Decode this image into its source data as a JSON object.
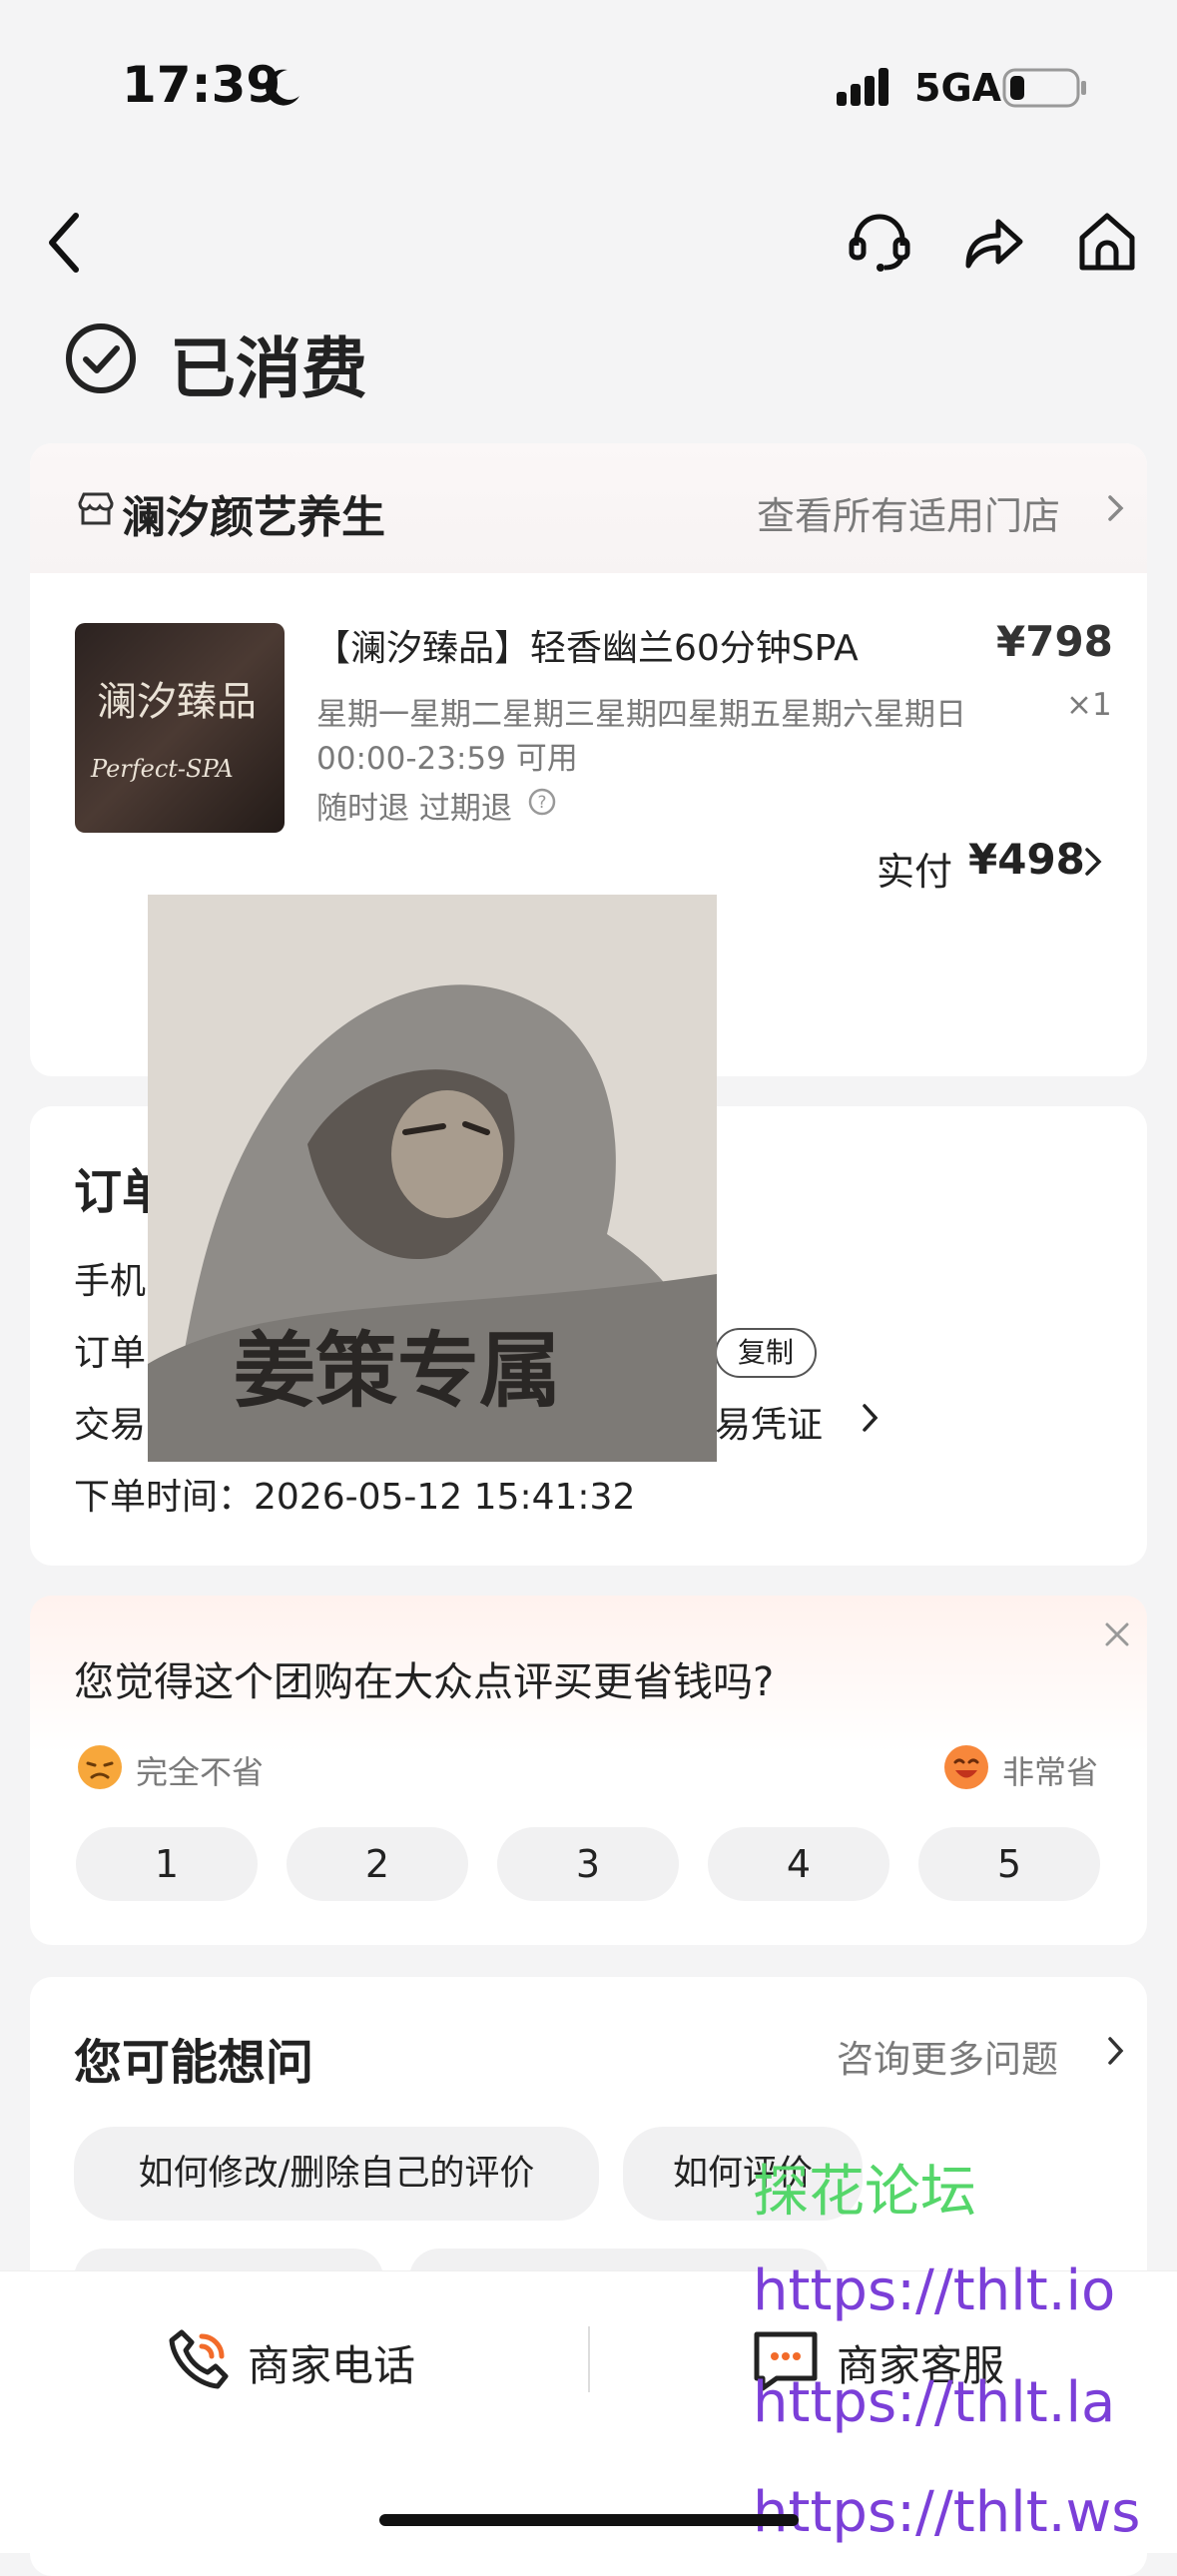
{
  "status_bar": {
    "time": "17:39",
    "network": "5GA"
  },
  "header": {
    "title": "已消费"
  },
  "shop": {
    "name": "澜汐颜艺养生",
    "all_stores_label": "查看所有适用门店"
  },
  "product": {
    "thumb_title": "澜汐臻品",
    "thumb_subtitle": "Perfect-SPA",
    "name": "【澜汐臻品】轻香幽兰60分钟SPA",
    "price": "¥798",
    "days": "星期一星期二星期三星期四星期五星期六星期日",
    "quantity": "×1",
    "hours": "00:00-23:59 可用",
    "refund": "随时退 过期退",
    "paid_label": "实付",
    "paid_amount": "¥498"
  },
  "sticker": {
    "caption": "姜策专属"
  },
  "order": {
    "title_partial": "订单",
    "phone_partial": "手机",
    "order_no_partial": "订单",
    "copy_label": "复制",
    "trade_partial": "交易",
    "voucher_partial": "易凭证",
    "order_time": "下单时间：2026-05-12 15:41:32"
  },
  "survey": {
    "question": "您觉得这个团购在大众点评买更省钱吗?",
    "low_label": "完全不省",
    "high_label": "非常省",
    "options": [
      "1",
      "2",
      "3",
      "4",
      "5"
    ]
  },
  "faq": {
    "title": "您可能想问",
    "more_label": "咨询更多问题",
    "chips": [
      "如何修改/删除自己的评价",
      "如何评价"
    ]
  },
  "watermark": {
    "forum": "探花论坛",
    "urls": [
      "https://thlt.io",
      "https://thlt.la",
      "https://thlt.ws"
    ]
  },
  "bottom_bar": {
    "phone_label": "商家电话",
    "service_label": "商家客服"
  }
}
